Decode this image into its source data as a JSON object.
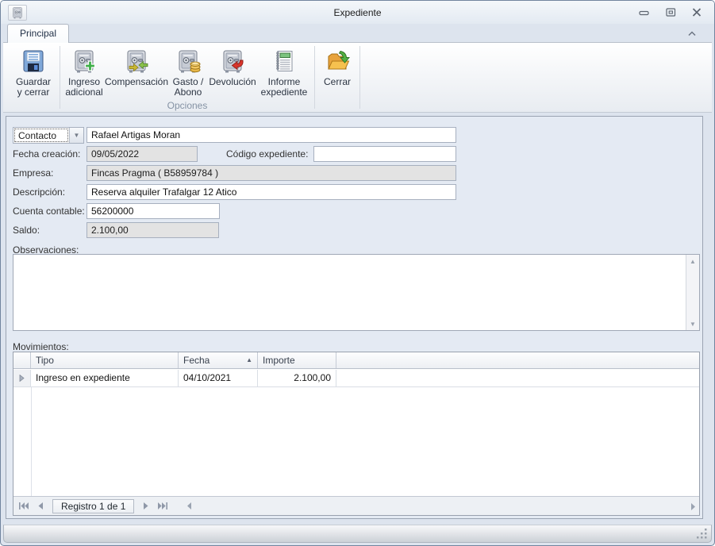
{
  "window": {
    "title": "Expediente",
    "icon": "safe-icon"
  },
  "ribbon": {
    "tab": "Principal",
    "groups": {
      "save": {
        "line1": "Guardar",
        "line2": "y cerrar",
        "icon": "save-icon"
      },
      "options": {
        "label": "Opciones",
        "buttons": [
          {
            "line1": "Ingreso",
            "line2": "adicional",
            "icon": "safe-add-icon"
          },
          {
            "line1": "Compensación",
            "line2": "",
            "icon": "safe-swap-icon"
          },
          {
            "line1": "Gasto /",
            "line2": "Abono",
            "icon": "safe-coins-icon"
          },
          {
            "line1": "Devolución",
            "line2": "",
            "icon": "safe-return-icon"
          },
          {
            "line1": "Informe",
            "line2": "expediente",
            "icon": "report-icon"
          }
        ]
      },
      "close": {
        "label": "Cerrar",
        "icon": "open-folder-arrow-icon"
      }
    }
  },
  "form": {
    "contacto": {
      "button_label": "Contacto",
      "value": "Rafael Artigas Moran"
    },
    "fecha_creacion": {
      "label": "Fecha creación:",
      "value": "09/05/2022"
    },
    "codigo_expediente": {
      "label": "Código expediente:",
      "value": ""
    },
    "empresa": {
      "label": "Empresa:",
      "value": "Fincas Pragma ( B58959784 )"
    },
    "descripcion": {
      "label": "Descripción:",
      "value": "Reserva alquiler Trafalgar 12 Atico"
    },
    "cuenta_contable": {
      "label": "Cuenta contable:",
      "value": "56200000"
    },
    "saldo": {
      "label": "Saldo:",
      "value": "2.100,00"
    },
    "observaciones": {
      "label": "Observaciones:",
      "value": ""
    }
  },
  "movimientos": {
    "label": "Movimientos:",
    "columns": {
      "tipo": "Tipo",
      "fecha": "Fecha",
      "importe": "Importe"
    },
    "sort": {
      "column": "Fecha",
      "direction": "asc"
    },
    "rows": [
      {
        "tipo": "Ingreso en expediente",
        "fecha": "04/10/2021",
        "importe": "2.100,00"
      }
    ],
    "navigator": {
      "record_label": "Registro 1 de 1"
    }
  },
  "colors": {
    "panel_bg": "#e4eaf3",
    "disabled_field_bg": "#e3e3e3",
    "chrome_border": "#71849e"
  }
}
